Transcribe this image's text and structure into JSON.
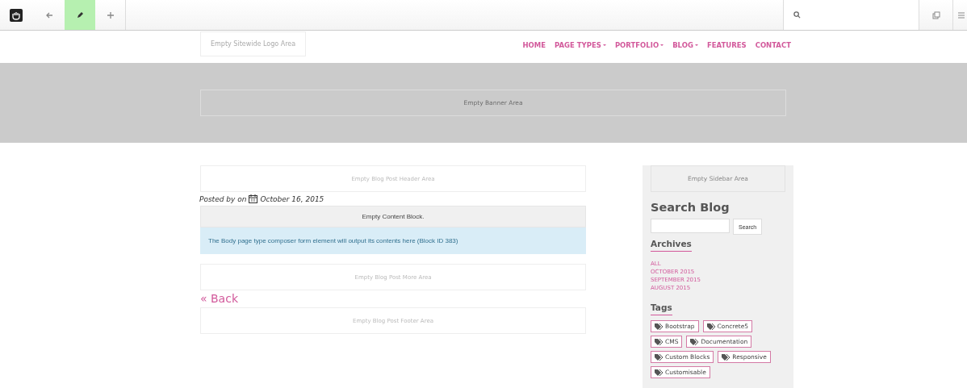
{
  "toolbar": {
    "buttons": [
      {
        "kind": "back",
        "selected": false
      },
      {
        "kind": "edit",
        "selected": true
      },
      {
        "kind": "add",
        "selected": false
      }
    ]
  },
  "header": {
    "logo_area": "Empty Sitewide Logo Area",
    "nav": [
      {
        "label": "HOME",
        "dropdown": false
      },
      {
        "label": "PAGE TYPES",
        "dropdown": true
      },
      {
        "label": "PORTFOLIO",
        "dropdown": true
      },
      {
        "label": "BLOG",
        "dropdown": true
      },
      {
        "label": "FEATURES",
        "dropdown": false
      },
      {
        "label": "CONTACT",
        "dropdown": false
      }
    ]
  },
  "banner": {
    "area": "Empty Banner Area"
  },
  "post": {
    "header_area": "Empty Blog Post Header Area",
    "byline": "Posted by on",
    "date": "October 16, 2015",
    "content_block": "Empty Content Block.",
    "composer_note": "The Body page type composer form element will output its contents here (Block ID 383)",
    "more_area": "Empty Blog Post More Area",
    "back_link": "« Back",
    "footer_area": "Empty Blog Post Footer Area"
  },
  "sidebar": {
    "area": "Empty Sidebar Area",
    "search_title": "Search Blog",
    "search_button": "Search",
    "archives_title": "Archives",
    "archives": [
      "ALL",
      "OCTOBER 2015",
      "SEPTEMBER 2015",
      "AUGUST 2015"
    ],
    "tags_title": "Tags",
    "tags": [
      "Bootstrap",
      "Concrete5",
      "CMS",
      "Documentation",
      "Custom Blocks",
      "Responsive",
      "Customisable"
    ]
  }
}
